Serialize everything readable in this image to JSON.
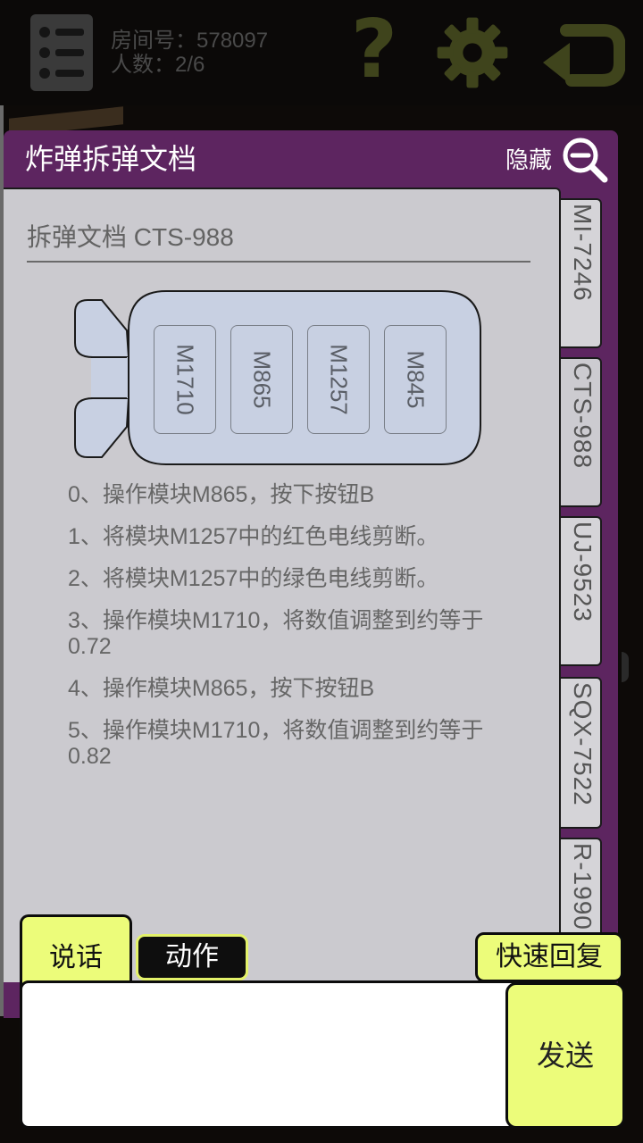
{
  "header": {
    "room_label": "房间号：578097",
    "people_label": "人数：2/6",
    "icons": {
      "menu": "menu-list-icon",
      "help": "question-icon",
      "settings": "gear-icon",
      "back": "return-arrow-icon"
    },
    "help_glyph": "?"
  },
  "panel": {
    "title": "炸弹拆弹文档",
    "hide_label": "隐藏"
  },
  "tabs": [
    {
      "label": "MI-7246"
    },
    {
      "label": "CTS-988"
    },
    {
      "label": "UJ-9523"
    },
    {
      "label": "SQX-7522"
    },
    {
      "label": "R-1990"
    }
  ],
  "document": {
    "title": "拆弹文档  CTS-988",
    "modules": [
      "M1710",
      "M865",
      "M1257",
      "M845"
    ],
    "steps": [
      "0、操作模块M865，按下按钮B",
      "1、将模块M1257中的红色电线剪断。",
      "2、将模块M1257中的绿色电线剪断。",
      "3、操作模块M1710，将数值调整到约等于0.72",
      "4、操作模块M865，按下按钮B",
      "5、操作模块M1710，将数值调整到约等于0.82"
    ]
  },
  "chat": {
    "speak_tab": "说话",
    "action_tab": "动作",
    "quick_reply": "快速回复",
    "send": "发送",
    "input_value": ""
  },
  "colors": {
    "accent_yellow": "#ecfc7a",
    "panel_purple": "#5d2560",
    "doc_gray": "#cbcacf",
    "icon_olive": "#3f441c"
  }
}
